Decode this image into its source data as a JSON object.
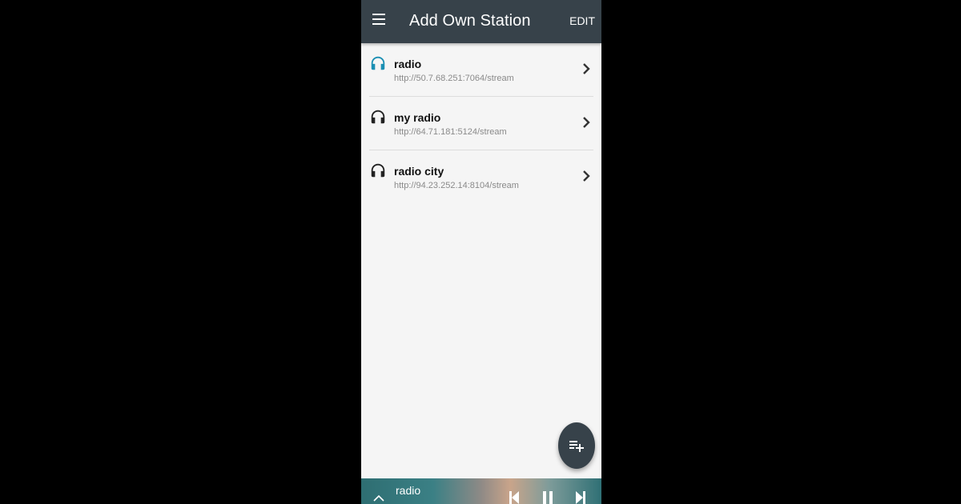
{
  "app": {
    "title": "Add Own Station",
    "edit_label": "EDIT",
    "accent_color": "#1b8fb3",
    "appbar_color": "#37424a"
  },
  "stations": [
    {
      "name": "radio",
      "url": "http://50.7.68.251:7064/stream",
      "icon": "headphones-icon",
      "active": true
    },
    {
      "name": "my radio",
      "url": "http://64.71.181:5124/stream",
      "icon": "headphones-icon",
      "active": false
    },
    {
      "name": "radio city",
      "url": "http://94.23.252.14:8104/stream",
      "icon": "headphones-icon",
      "active": false
    }
  ],
  "fab": {
    "icon": "playlist-add-icon"
  },
  "player": {
    "title": "radio",
    "controls": [
      "skip-previous-icon",
      "pause-icon",
      "skip-next-icon"
    ]
  }
}
